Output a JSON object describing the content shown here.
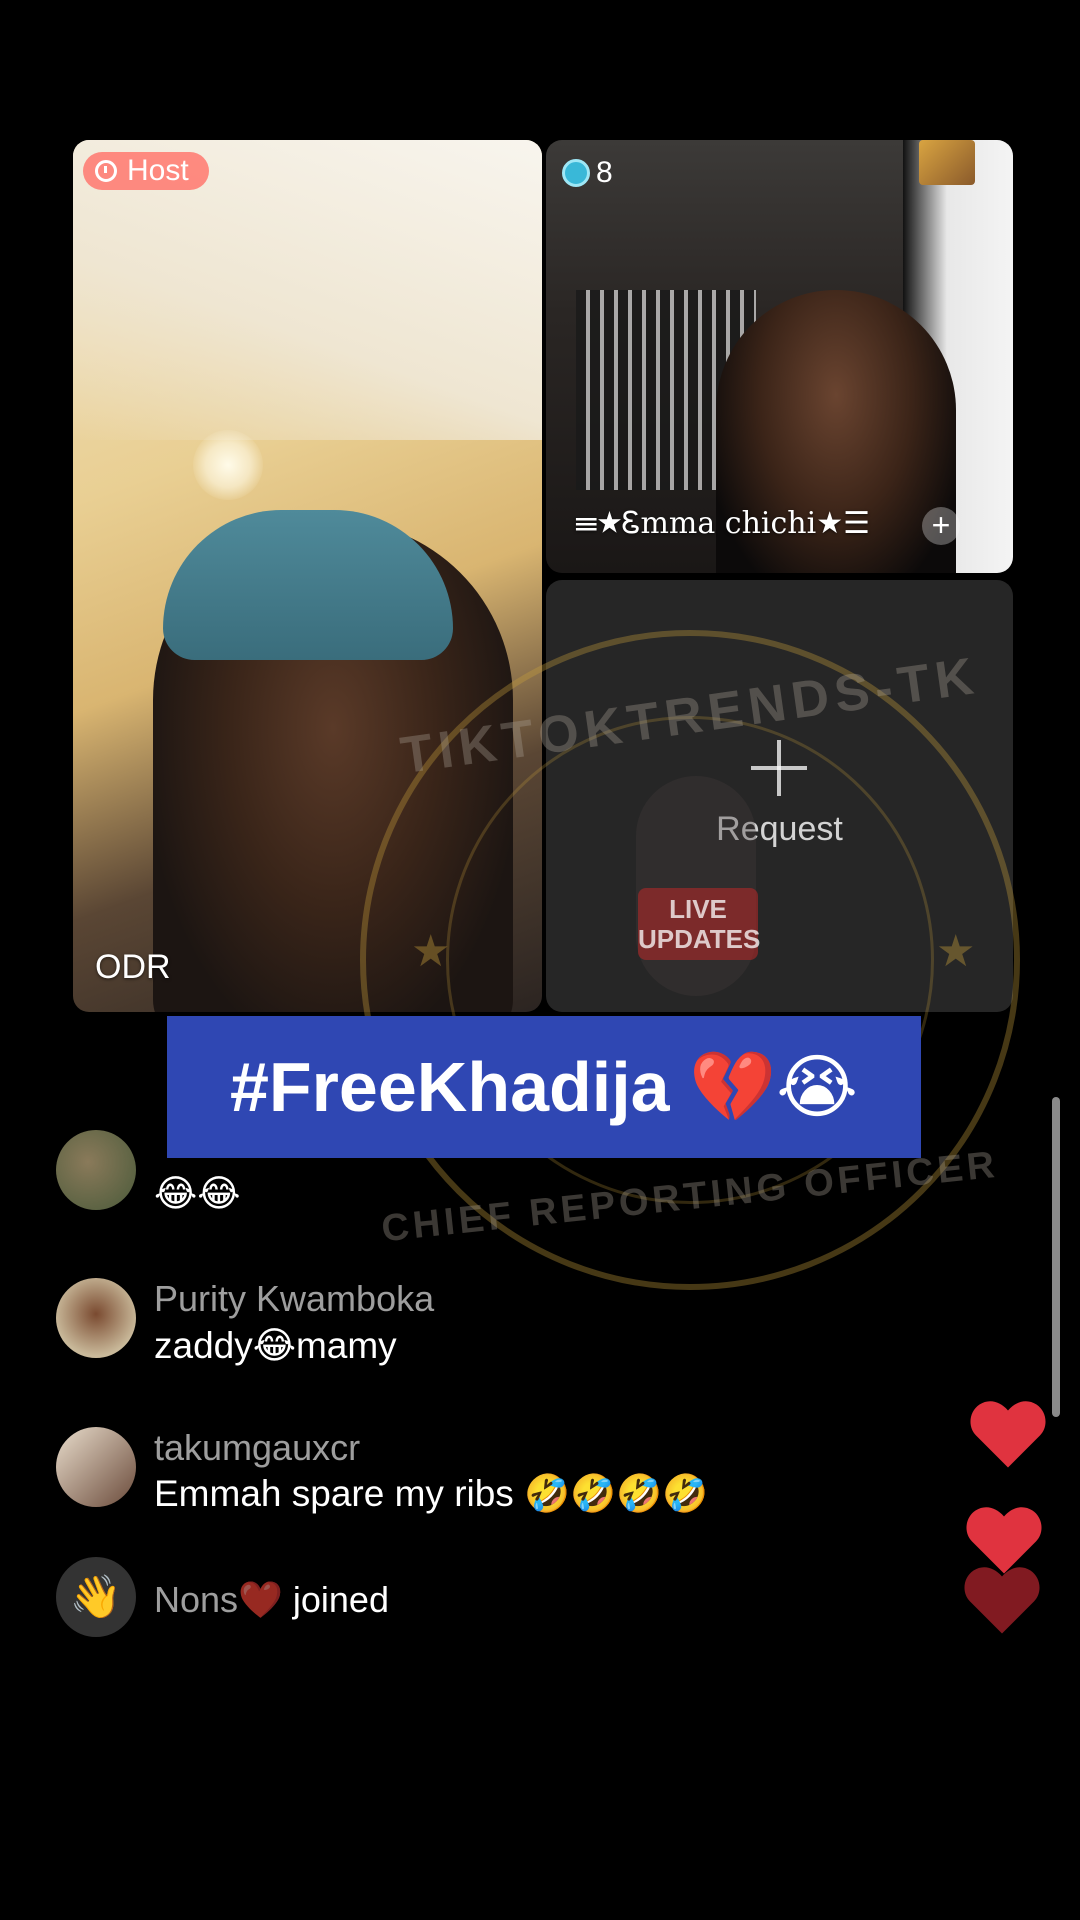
{
  "host": {
    "badge_label": "Host",
    "name": "ODR"
  },
  "guest": {
    "viewer_count": "8",
    "name": "☰★Ꮛmma chichi★☰"
  },
  "request_slot": {
    "label": "Request"
  },
  "banner": {
    "text": "#FreeKhadija 💔😭"
  },
  "watermark": {
    "top_text": "TIKTOKTRENDS-TK",
    "bottom_text": "CHIEF REPORTING OFFICER",
    "live_badge": "LIVE UPDATES"
  },
  "chat": [
    {
      "name": "",
      "text": "😂😂"
    },
    {
      "name": "Purity Kwamboka",
      "text": "zaddy😂mamy"
    },
    {
      "name": "takumgauxcr",
      "text": "Emmah spare my ribs 🤣🤣🤣🤣"
    },
    {
      "name": "Nons❤️",
      "joined_text": "joined"
    }
  ],
  "colors": {
    "banner_bg": "#2f47b3",
    "host_badge_bg": "#ff786e",
    "heart": "#e0333f"
  }
}
